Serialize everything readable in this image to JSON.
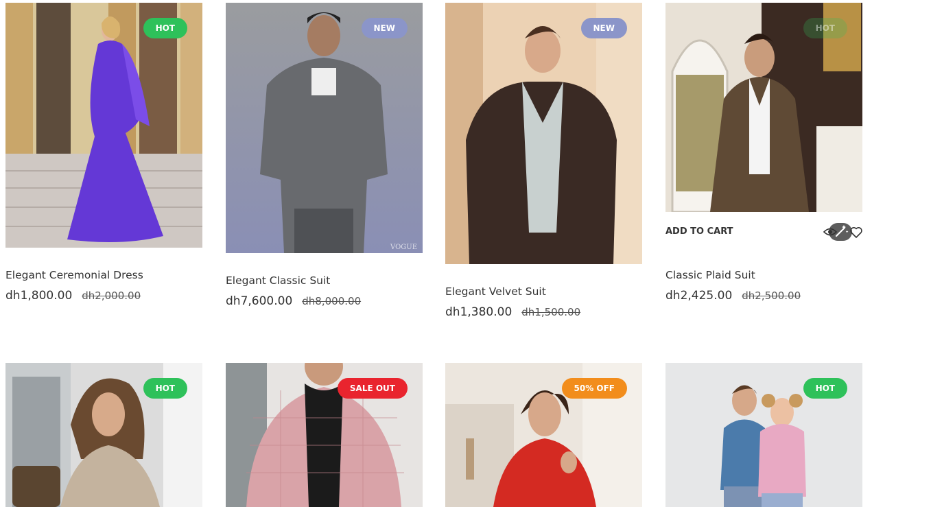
{
  "products": [
    {
      "name": "Elegant Ceremonial Dress",
      "price": "dh1,800.00",
      "old_price": "dh2,000.00",
      "badge": "HOT",
      "badge_type": "hot",
      "photo": "woman-in-purple-gown"
    },
    {
      "name": "Elegant Classic Suit",
      "price": "dh7,600.00",
      "old_price": "dh8,000.00",
      "badge": "NEW",
      "badge_type": "new",
      "photo": "man-in-grey-suit",
      "watermark": "VOGUE"
    },
    {
      "name": "Elegant Velvet Suit",
      "price": "dh1,380.00",
      "old_price": "dh1,500.00",
      "badge": "NEW",
      "badge_type": "new",
      "photo": "man-in-velvet-suit"
    },
    {
      "name": "Classic Plaid Suit",
      "price": "dh2,425.00",
      "old_price": "dh2,500.00",
      "badge": "HOT",
      "badge_type": "hot",
      "photo": "man-in-plaid-suit",
      "add_to_cart": "ADD TO CART",
      "icons": [
        "eye-icon",
        "magic-wand-icon",
        "heart-icon"
      ]
    },
    {
      "badge": "HOT",
      "badge_type": "hot",
      "photo": "woman-in-beige-blazer"
    },
    {
      "badge": "SALE OUT",
      "badge_type": "sale",
      "photo": "man-in-pink-blazer"
    },
    {
      "badge": "50% OFF",
      "badge_type": "off",
      "photo": "woman-in-red-blazer"
    },
    {
      "badge": "HOT",
      "badge_type": "hot",
      "photo": "kids-in-vests"
    }
  ],
  "colors": {
    "hot": "#2ec15a",
    "new": "#8b95c9",
    "sale": "#e9242e",
    "off": "#f28d1c",
    "text": "#333333"
  }
}
